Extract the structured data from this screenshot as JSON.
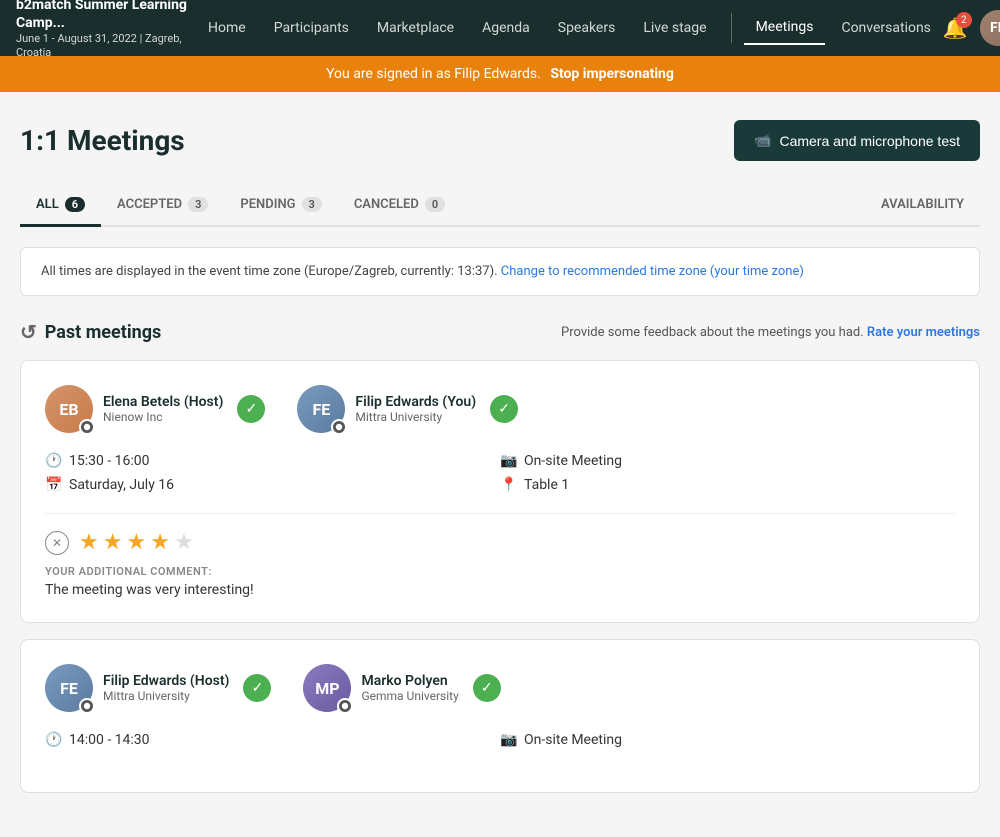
{
  "brand": {
    "name": "b2match Summer Learning Camp...",
    "date": "June 1 - August 31, 2022 | Zagreb, Croatia"
  },
  "nav": {
    "links": [
      "Home",
      "Participants",
      "Marketplace",
      "Agenda",
      "Speakers",
      "Live stage"
    ],
    "active": "Meetings",
    "right_link": "Conversations",
    "bell_count": "2"
  },
  "impersonation": {
    "message": "You are signed in as Filip Edwards.",
    "action": "Stop impersonating"
  },
  "page": {
    "title": "1:1 Meetings",
    "camera_button": "Camera and microphone test"
  },
  "tabs": [
    {
      "label": "ALL",
      "count": "6",
      "active": true
    },
    {
      "label": "ACCEPTED",
      "count": "3",
      "active": false
    },
    {
      "label": "PENDING",
      "count": "3",
      "active": false
    },
    {
      "label": "CANCELED",
      "count": "0",
      "active": false
    },
    {
      "label": "AVAILABILITY",
      "count": null,
      "active": false
    }
  ],
  "timezone_notice": {
    "text": "All times are displayed in the event time zone (Europe/Zagreb, currently: 13:37).",
    "link_text": "Change to recommended time zone (your time zone)"
  },
  "past_meetings": {
    "section_title": "Past meetings",
    "feedback_text": "Provide some feedback about the meetings you had.",
    "rate_link": "Rate your meetings",
    "meetings": [
      {
        "participants": [
          {
            "name": "Elena Betels (Host)",
            "org": "Nienow Inc",
            "avatar_initials": "EB",
            "avatar_class": "av-elena",
            "accepted": true
          },
          {
            "name": "Filip Edwards (You)",
            "org": "Mittra University",
            "avatar_initials": "FE",
            "avatar_class": "av-filip",
            "accepted": true
          }
        ],
        "time": "15:30 - 16:00",
        "date": "Saturday, July 16",
        "type": "On-site Meeting",
        "location": "Table 1",
        "rating": 4,
        "max_rating": 5,
        "comment_label": "YOUR ADDITIONAL COMMENT:",
        "comment": "The meeting was very interesting!"
      },
      {
        "participants": [
          {
            "name": "Filip Edwards (Host)",
            "org": "Mittra University",
            "avatar_initials": "FE",
            "avatar_class": "av-filip",
            "accepted": true
          },
          {
            "name": "Marko Polyen",
            "org": "Gemma University",
            "avatar_initials": "MP",
            "avatar_class": "av-marko",
            "accepted": true
          }
        ],
        "time": "14:00 - 14:30",
        "date": null,
        "type": "On-site Meeting",
        "location": null,
        "rating": 0,
        "max_rating": 5,
        "comment_label": null,
        "comment": null
      }
    ]
  }
}
